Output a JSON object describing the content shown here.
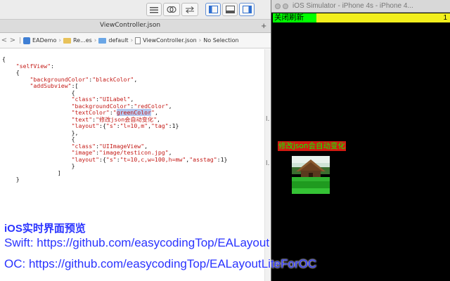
{
  "xcode": {
    "tab_title": "ViewController.json",
    "tab_plus": "+",
    "jumpbar": {
      "back": "<",
      "forward": ">",
      "items": [
        "EADemo",
        "Re...es",
        "default",
        "ViewController.json",
        "No Selection"
      ]
    },
    "code_lines": [
      {
        "text": "{"
      },
      {
        "text": "    \"selfView\":"
      },
      {
        "text": "    {"
      },
      {
        "text": "        \"backgroundColor\":\"blackColor\","
      },
      {
        "text": "        \"addSubview\":["
      },
      {
        "text": "                    {"
      },
      {
        "text": "                    \"class\":\"UILabel\","
      },
      {
        "text": "                    \"backgroundColor\":\"redColor\","
      },
      {
        "pre": "                    \"textColor\":\"",
        "hl": "greenColor",
        "post": "\","
      },
      {
        "text": "                    \"text\":\"修改json会自动变化\","
      },
      {
        "text": "                    \"layout\":{\"s\":\"l=10,m\",\"tag\":1}"
      },
      {
        "text": "                    },"
      },
      {
        "text": "                    {"
      },
      {
        "text": "                    \"class\":\"UIImageView\","
      },
      {
        "text": "                    \"image\":\"image/testicon.jpg\","
      },
      {
        "text": "                    \"layout\":{\"s\":\"t=10,c,w=100,h=mw\",\"asstag\":1}"
      },
      {
        "text": "                    }"
      },
      {
        "text": "                ]"
      },
      {
        "text": "    }"
      }
    ]
  },
  "simulator": {
    "window_title": "iOS Simulator - iPhone 4s - iPhone 4...",
    "refresh_button": "关闭刷新",
    "counter": "1",
    "label_text": "修改json会自动变化",
    "colors": {
      "label_bg": "#d21a11",
      "label_fg": "#00ff00",
      "button_bg": "#00ff00",
      "bar_bg": "#f2ef1d",
      "screen_bg": "#000000"
    }
  },
  "overlay": {
    "title": "iOS实时界面预览",
    "swift_line": "Swift: https://github.com/easycodingTop/EALayout",
    "oc_line": "OC: https://github.com/easycodingTop/EALayoutLiteForOC",
    "color": "#2a33ff"
  },
  "icons": [
    "list-icon",
    "venn-icon",
    "swap-arrows-icon",
    "left-panel-icon",
    "bottom-panel-icon",
    "right-panel-icon"
  ]
}
